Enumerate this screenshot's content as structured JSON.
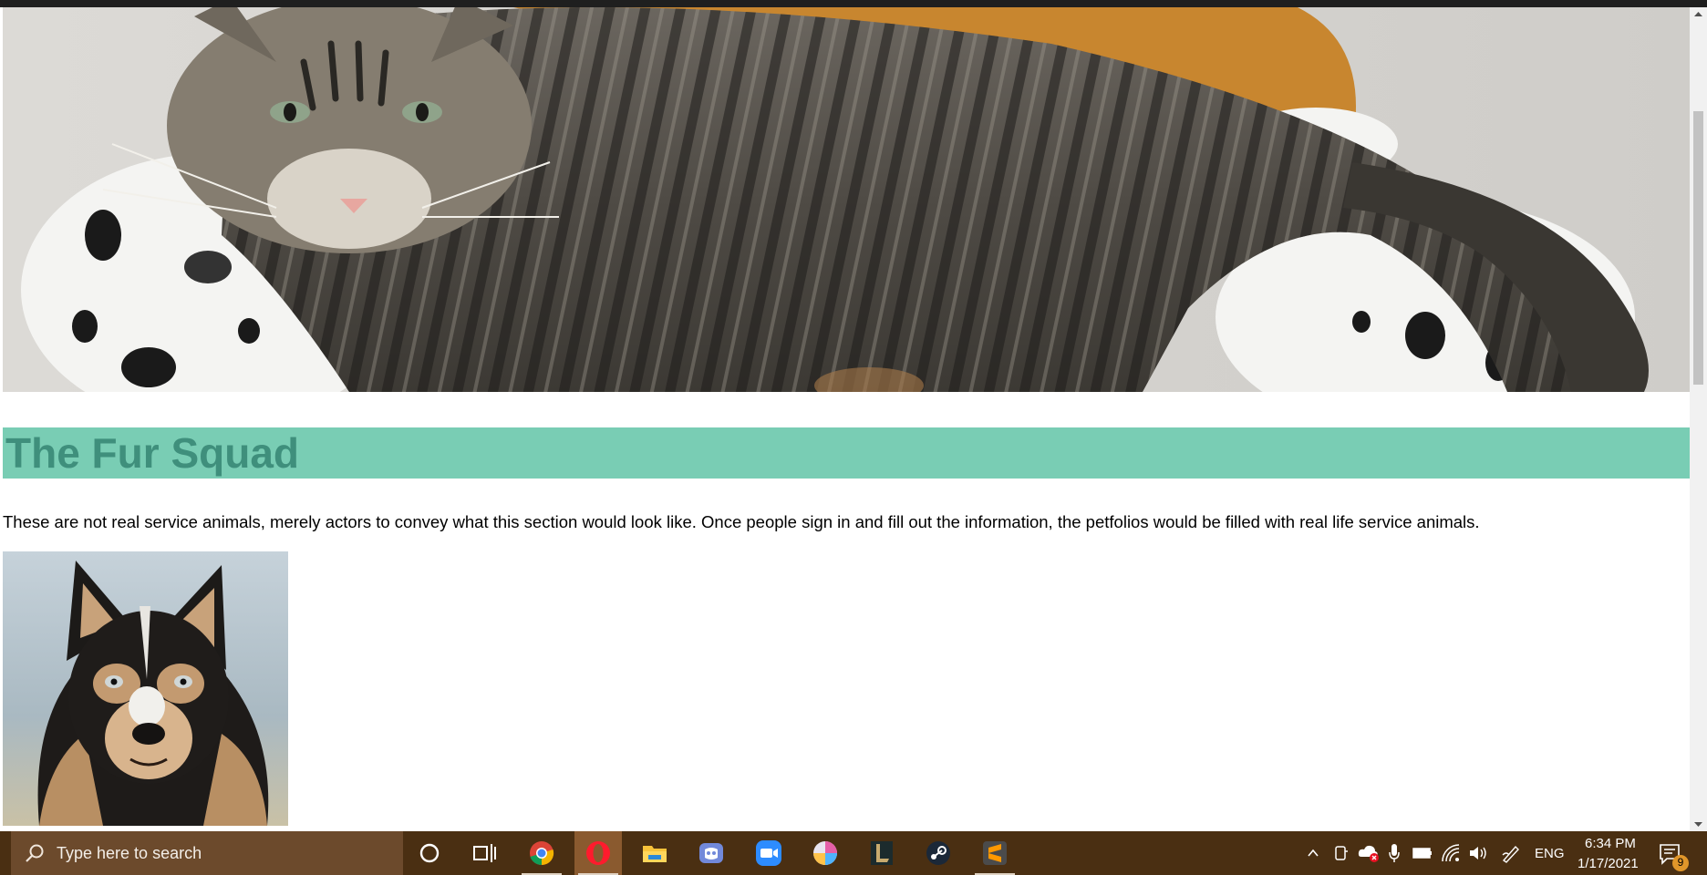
{
  "page": {
    "title": "The Fur Squad",
    "intro": "These are not real service animals, merely actors to convey what this section would look like. Once people sign in and fill out the information, the petfolios would be filled with real life service animals."
  },
  "images": {
    "hero_alt": "tabby cat resting on dalmatian print cushion",
    "dog_alt": "husky dog portrait"
  },
  "taskbar": {
    "search_placeholder": "Type here to search",
    "apps": [
      "search-icon",
      "cortana-icon",
      "task-view-icon",
      "chrome-icon",
      "opera-icon",
      "file-explorer-icon",
      "discord-icon",
      "zoom-icon",
      "paint-icon",
      "league-icon",
      "steam-icon",
      "sublime-icon"
    ],
    "tray": {
      "language": "ENG",
      "time": "6:34 PM",
      "date": "1/17/2021",
      "notification_count": "9"
    }
  },
  "colors": {
    "accent_band": "#79cdb4",
    "title_text": "#3f8f7c",
    "taskbar": "#4a2f12"
  }
}
